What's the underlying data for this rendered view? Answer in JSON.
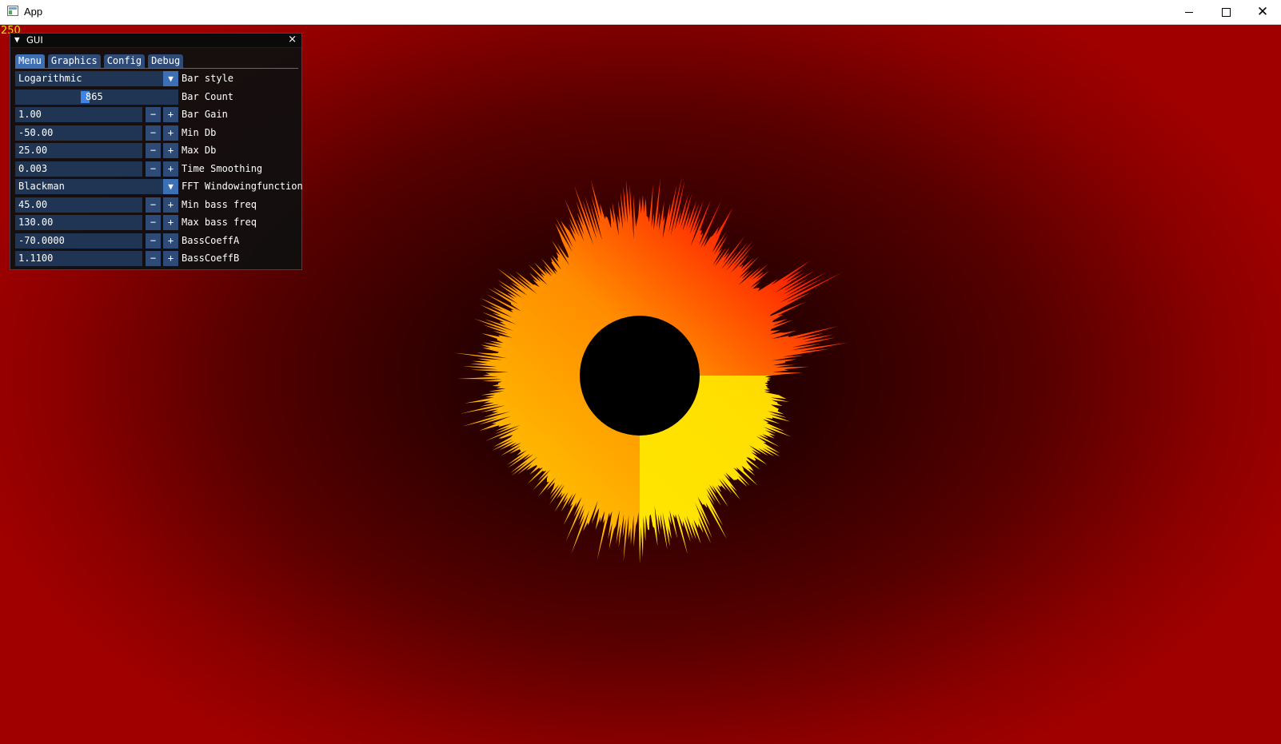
{
  "window": {
    "title": "App",
    "icons": [
      "app-icon",
      "minimize-icon",
      "maximize-icon",
      "close-icon"
    ]
  },
  "overlay": {
    "fps": "250"
  },
  "colors": {
    "bg_center": "#1a0000",
    "bg_edge": "#a00000",
    "ring_red": "#ff1a00",
    "ring_orange": "#ff8c00",
    "ring_yellow": "#ffee00",
    "accent": "#3d6fb5"
  },
  "gui": {
    "title": "GUI",
    "tabs": [
      {
        "label": "Menu",
        "active": true
      },
      {
        "label": "Graphics",
        "active": false
      },
      {
        "label": "Config",
        "active": false
      },
      {
        "label": "Debug",
        "active": false
      }
    ],
    "rows": [
      {
        "type": "combo",
        "value": "Logarithmic",
        "label": "Bar style"
      },
      {
        "type": "slider",
        "value": "865",
        "label": "Bar Count"
      },
      {
        "type": "number",
        "value": "1.00",
        "label": "Bar Gain"
      },
      {
        "type": "number",
        "value": "-50.00",
        "label": "Min Db"
      },
      {
        "type": "number",
        "value": "25.00",
        "label": "Max Db"
      },
      {
        "type": "number",
        "value": "0.003",
        "label": "Time Smoothing"
      },
      {
        "type": "combo",
        "value": "Blackman",
        "label": "FFT Windowingfunction"
      },
      {
        "type": "number",
        "value": "45.00",
        "label": "Min bass freq"
      },
      {
        "type": "number",
        "value": "130.00",
        "label": "Max bass freq"
      },
      {
        "type": "number",
        "value": "-70.0000",
        "label": "BassCoeffA"
      },
      {
        "type": "number",
        "value": "1.1100",
        "label": "BassCoeffB"
      }
    ],
    "minus": "−",
    "plus": "+"
  }
}
